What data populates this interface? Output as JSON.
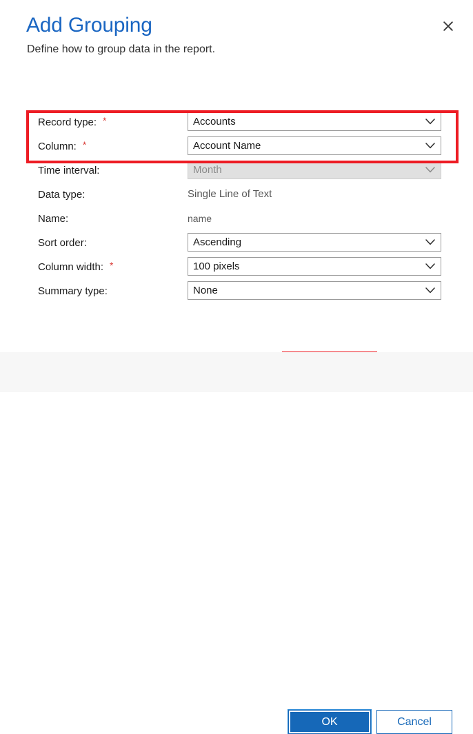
{
  "dialog": {
    "title": "Add Grouping",
    "subtitle": "Define how to group data in the report.",
    "close_icon": "close-icon"
  },
  "form": {
    "required_marker": "*",
    "rows": [
      {
        "label": "Record type:",
        "required": true,
        "control": "dropdown",
        "value": "Accounts",
        "disabled": false,
        "name": "record-type"
      },
      {
        "label": "Column:",
        "required": true,
        "control": "dropdown",
        "value": "Account Name",
        "disabled": false,
        "name": "column"
      },
      {
        "label": "Time interval:",
        "required": false,
        "control": "dropdown",
        "value": "Month",
        "disabled": true,
        "name": "time-interval"
      },
      {
        "label": "Data type:",
        "required": false,
        "control": "static",
        "value": "Single Line of Text",
        "disabled": false,
        "name": "data-type"
      },
      {
        "label": "Name:",
        "required": false,
        "control": "static",
        "value": "name",
        "disabled": false,
        "name": "name"
      },
      {
        "label": "Sort order:",
        "required": false,
        "control": "dropdown",
        "value": "Ascending",
        "disabled": false,
        "name": "sort-order"
      },
      {
        "label": "Column width:",
        "required": true,
        "control": "dropdown",
        "value": "100 pixels",
        "disabled": false,
        "name": "column-width"
      },
      {
        "label": "Summary type:",
        "required": false,
        "control": "dropdown",
        "value": "None",
        "disabled": false,
        "name": "summary-type"
      }
    ]
  },
  "footer": {
    "ok_label": "OK",
    "cancel_label": "Cancel"
  },
  "colors": {
    "title_blue": "#1a66c2",
    "accent_blue": "#1668b8",
    "required_red": "#d93a36",
    "annotation_red": "#ed1c24",
    "footer_bg": "#f7f7f7",
    "disabled_bg": "#e0e0e0"
  },
  "annotations": [
    {
      "name": "annotation-fields",
      "target": "record-type-and-column-rows"
    },
    {
      "name": "annotation-ok",
      "target": "ok-button"
    }
  ]
}
